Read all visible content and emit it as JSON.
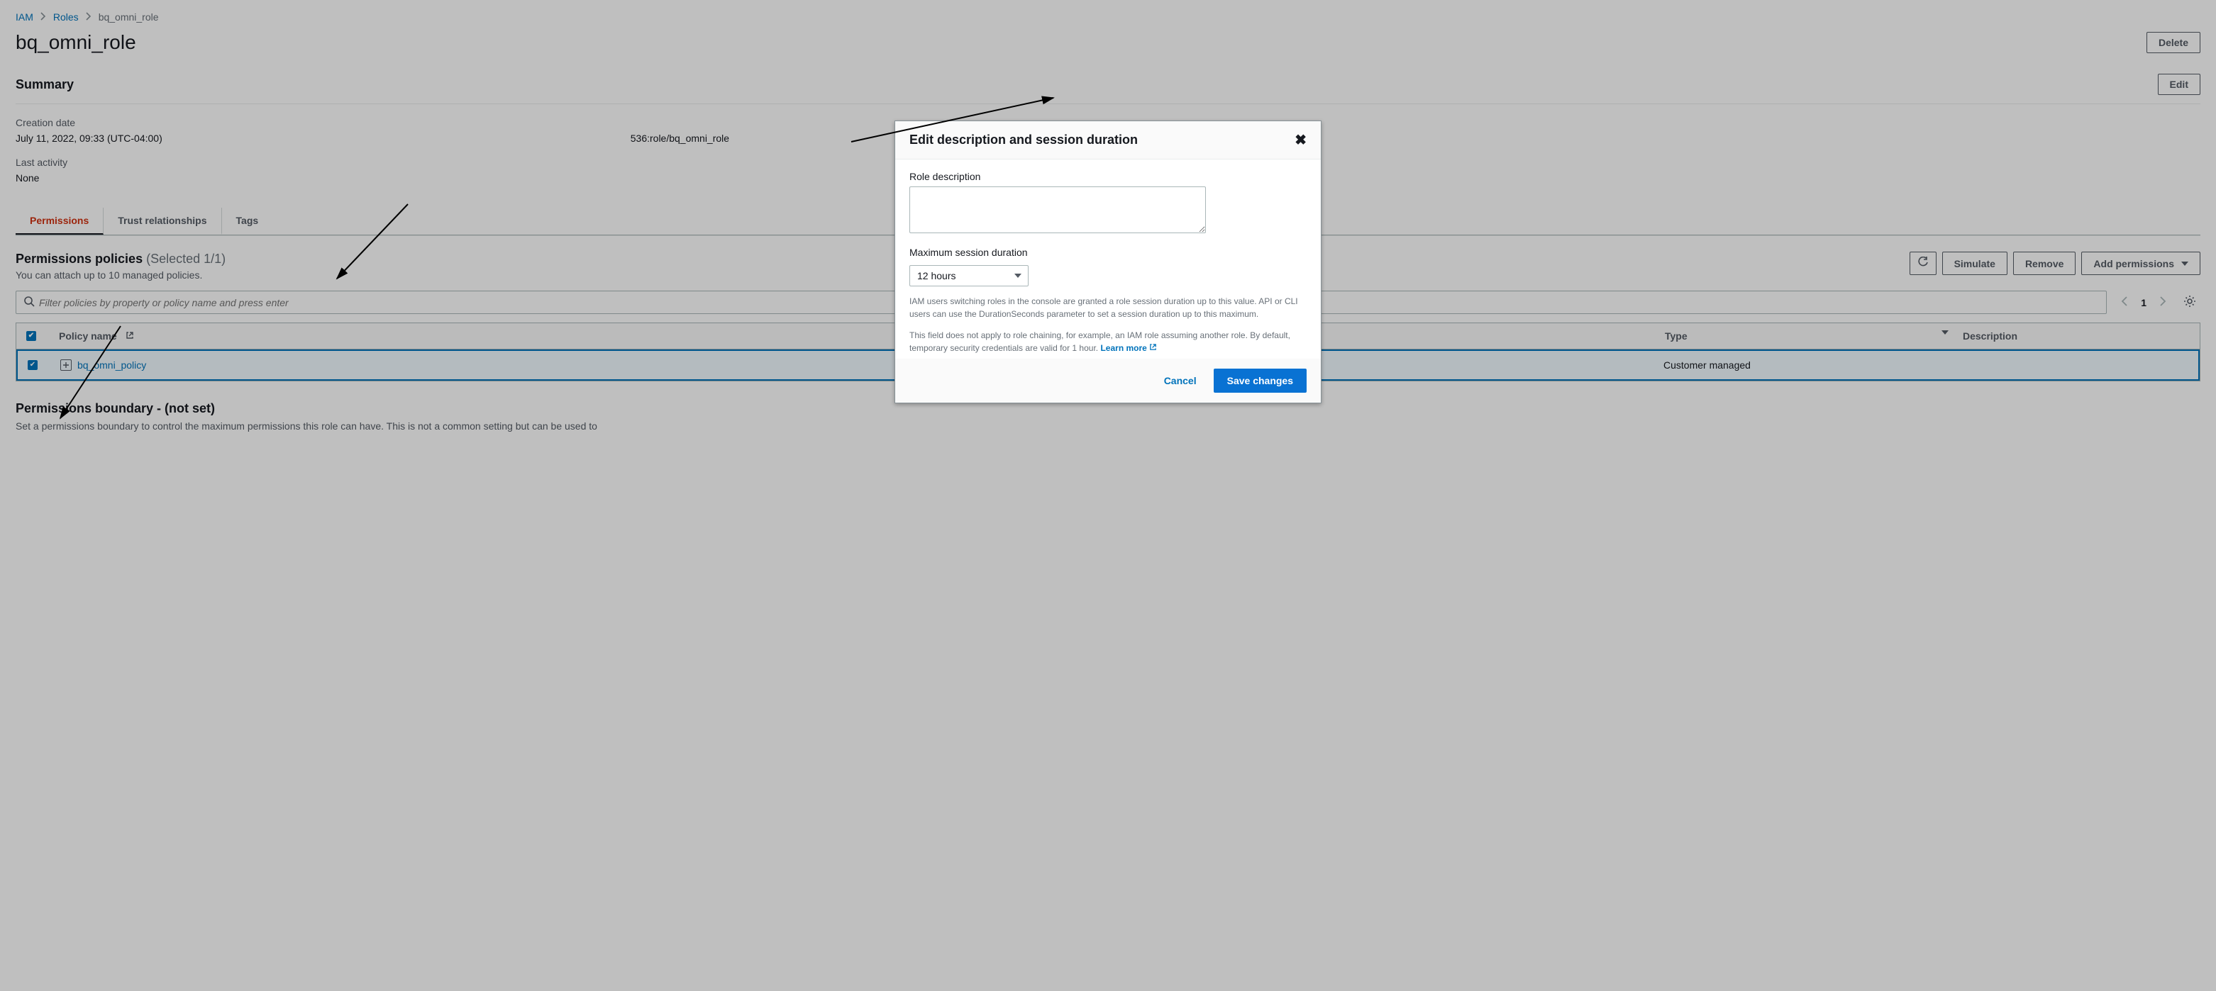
{
  "breadcrumbs": {
    "iam": "IAM",
    "roles": "Roles",
    "current": "bq_omni_role"
  },
  "header": {
    "title": "bq_omni_role",
    "delete": "Delete"
  },
  "summary": {
    "heading": "Summary",
    "edit": "Edit",
    "creation_date_label": "Creation date",
    "creation_date_value": "July 11, 2022, 09:33 (UTC-04:00)",
    "last_activity_label": "Last activity",
    "last_activity_value": "None",
    "arn_suffix": "536:role/bq_omni_role"
  },
  "tabs": {
    "permissions": "Permissions",
    "trust": "Trust relationships",
    "tags": "Tags"
  },
  "permissions": {
    "title": "Permissions policies",
    "selected": "(Selected 1/1)",
    "sub": "You can attach up to 10 managed policies.",
    "simulate": "Simulate",
    "remove": "Remove",
    "add": "Add permissions",
    "filter_placeholder": "Filter policies by property or policy name and press enter",
    "page_num": "1",
    "columns": {
      "name": "Policy name",
      "type": "Type",
      "desc": "Description"
    },
    "rows": [
      {
        "name": "bq_omni_policy",
        "type": "Customer managed",
        "desc": ""
      }
    ]
  },
  "boundary": {
    "title": "Permissions boundary - (not set)",
    "sub": "Set a permissions boundary to control the maximum permissions this role can have. This is not a common setting but can be used to"
  },
  "modal": {
    "title": "Edit description and session duration",
    "role_desc_label": "Role description",
    "max_session_label": "Maximum session duration",
    "max_session_value": "12 hours",
    "help1": "IAM users switching roles in the console are granted a role session duration up to this value. API or CLI users can use the DurationSeconds parameter to set a session duration up to this maximum.",
    "help2": "This field does not apply to role chaining, for example, an IAM role assuming another role. By default, temporary security credentials are valid for 1 hour.",
    "learn_more": "Learn more",
    "cancel": "Cancel",
    "save": "Save changes"
  }
}
